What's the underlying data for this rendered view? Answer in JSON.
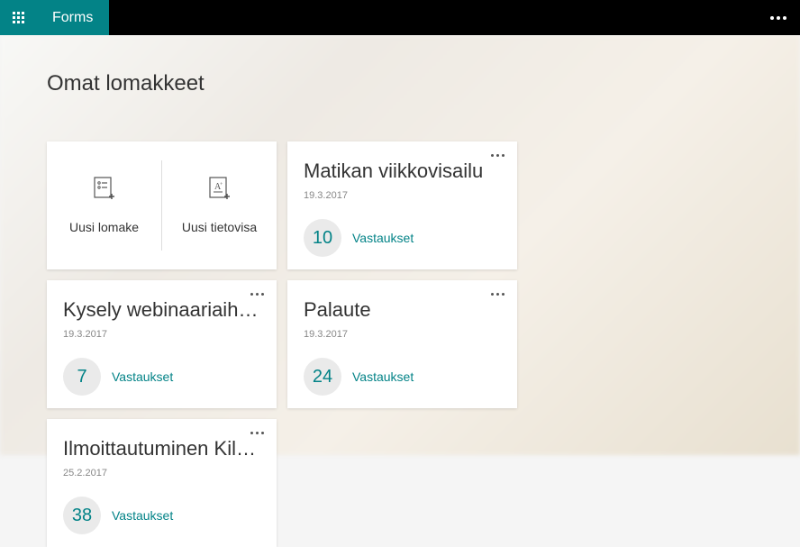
{
  "header": {
    "app_name": "Forms"
  },
  "page": {
    "title": "Omat lomakkeet"
  },
  "new_tile": {
    "new_form": "Uusi lomake",
    "new_quiz": "Uusi tietovisa"
  },
  "responses_label": "Vastaukset",
  "forms": [
    {
      "title": "Matikan viikkovisailu",
      "date": "19.3.2017",
      "count": "10"
    },
    {
      "title": "Kysely webinaariaihe…",
      "date": "19.3.2017",
      "count": "7"
    },
    {
      "title": "Palaute",
      "date": "19.3.2017",
      "count": "24"
    },
    {
      "title": "Ilmoittautuminen Kil…",
      "date": "25.2.2017",
      "count": "38"
    }
  ]
}
